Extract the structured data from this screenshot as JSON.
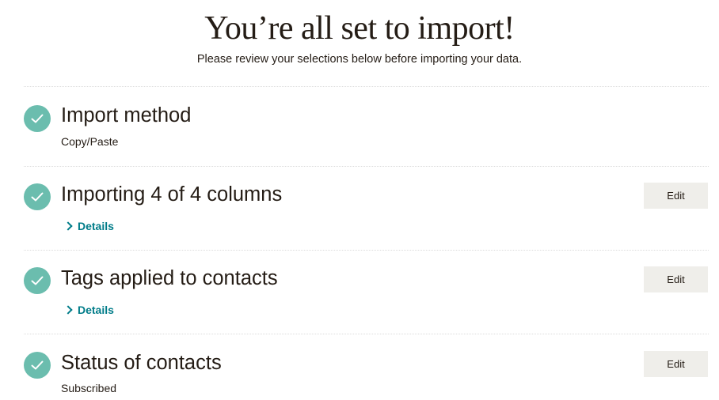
{
  "header": {
    "title": "You’re all set to import!",
    "subtitle": "Please review your selections below before importing your data."
  },
  "sections": [
    {
      "title": "Import method",
      "subtitle": "Copy/Paste"
    },
    {
      "title": "Importing 4 of 4 columns",
      "details_label": "Details",
      "edit_label": "Edit"
    },
    {
      "title": "Tags applied to contacts",
      "details_label": "Details",
      "edit_label": "Edit"
    },
    {
      "title": "Status of contacts",
      "subtitle": "Subscribed",
      "edit_label": "Edit"
    }
  ],
  "colors": {
    "check": "#6bbdae",
    "link": "#007c89",
    "button_bg": "#efeeea",
    "text": "#241c15"
  }
}
